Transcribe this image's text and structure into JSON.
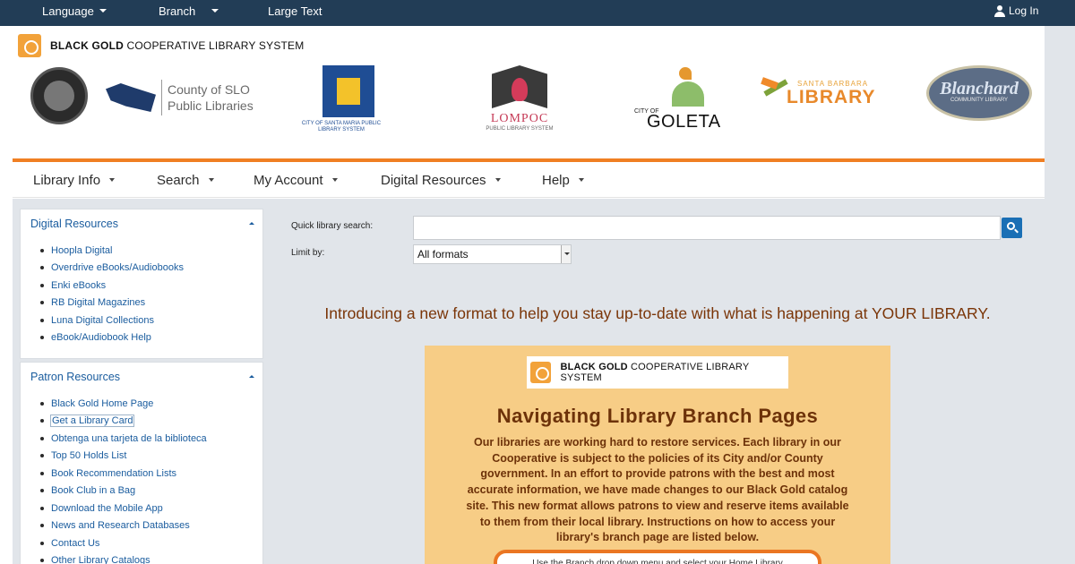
{
  "topbar": {
    "language": "Language",
    "branch": "Branch",
    "large_text": "Large Text",
    "login": "Log In"
  },
  "header": {
    "system_name_bold": "BLACK GOLD",
    "system_name_rest": " COOPERATIVE LIBRARY SYSTEM",
    "slo_line1": "County of SLO",
    "slo_line2": "Public Libraries",
    "santa_maria_caption": "CITY OF SANTA MARIA PUBLIC LIBRARY SYSTEM",
    "lompoc_name": "LOMPOC",
    "lompoc_sub": "PUBLIC LIBRARY SYSTEM",
    "goleta_city": "CITY OF",
    "goleta_name": "GOLETA",
    "sb_small": "SANTA BARBARA",
    "sb_big": "LIBRARY",
    "blanchard_name": "Blanchard",
    "blanchard_sub": "COMMUNITY LIBRARY"
  },
  "nav": {
    "items": [
      {
        "label": "Library Info"
      },
      {
        "label": "Search"
      },
      {
        "label": "My Account"
      },
      {
        "label": "Digital Resources"
      },
      {
        "label": "Help"
      }
    ]
  },
  "sidebar": {
    "digital": {
      "title": "Digital Resources",
      "items": [
        "Hoopla Digital",
        "Overdrive eBooks/Audiobooks",
        "Enki eBooks",
        "RB Digital Magazines",
        "Luna Digital Collections",
        "eBook/Audiobook Help"
      ]
    },
    "patron": {
      "title": "Patron Resources",
      "items": [
        "Black Gold Home Page",
        "Get a Library Card",
        "Obtenga una tarjeta de la biblioteca",
        "Top 50 Holds List",
        "Book Recommendation Lists",
        "Book Club in a Bag",
        "Download the Mobile App",
        "News and Research Databases",
        "Contact Us",
        "Other Library Catalogs"
      ]
    }
  },
  "search": {
    "quick_label": "Quick library search:",
    "quick_value": "",
    "limit_label": "Limit by:",
    "limit_value": "All formats"
  },
  "main": {
    "intro": "Introducing a new format to help you stay up-to-date with what is happening at YOUR LIBRARY.",
    "flyer": {
      "title": "Navigating Library Branch Pages",
      "body": "Our libraries are working hard to restore services. Each library in our Cooperative is subject to the policies of its City and/or County government. In an effort to provide patrons with the best and most accurate information, we have made changes to our Black Gold catalog site. This new format allows patrons to view and reserve items available to them from their local library. Instructions on how to access your library's branch page are listed below.",
      "pill": "Use the Branch drop down menu and select your Home Library"
    }
  },
  "colors": {
    "topbar": "#223d56",
    "accent_orange": "#f07f23",
    "link_blue": "#1a5c9e",
    "content_bg": "#e1e5ea",
    "flyer_bg": "#f7cd86",
    "flyer_text": "#6d3209"
  }
}
